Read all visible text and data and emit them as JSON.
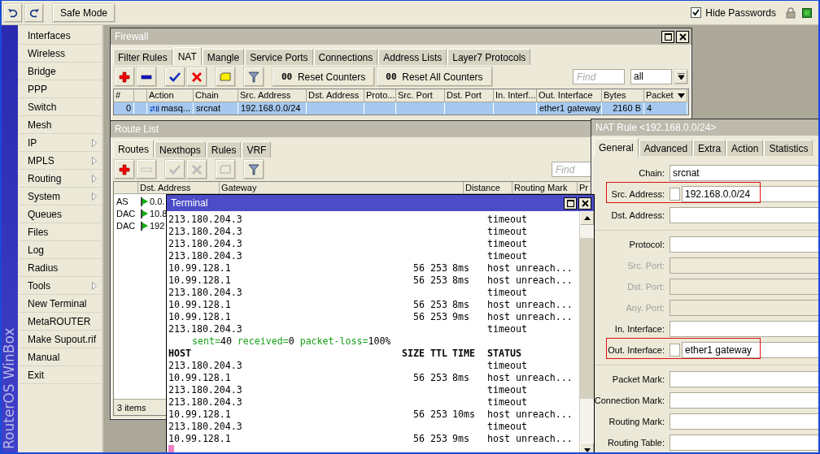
{
  "top_bar": {
    "safe_mode": "Safe Mode",
    "hide_passwords": {
      "label": "Hide Passwords",
      "checked": true
    }
  },
  "sidebar": {
    "brand": "RouterOS WinBox",
    "items": [
      {
        "label": "Interfaces",
        "submenu": false
      },
      {
        "label": "Wireless",
        "submenu": false
      },
      {
        "label": "Bridge",
        "submenu": false
      },
      {
        "label": "PPP",
        "submenu": false
      },
      {
        "label": "Switch",
        "submenu": false
      },
      {
        "label": "Mesh",
        "submenu": false
      },
      {
        "label": "IP",
        "submenu": true
      },
      {
        "label": "MPLS",
        "submenu": true
      },
      {
        "label": "Routing",
        "submenu": true
      },
      {
        "label": "System",
        "submenu": true
      },
      {
        "label": "Queues",
        "submenu": false
      },
      {
        "label": "Files",
        "submenu": false
      },
      {
        "label": "Log",
        "submenu": false
      },
      {
        "label": "Radius",
        "submenu": false
      },
      {
        "label": "Tools",
        "submenu": true
      },
      {
        "label": "New Terminal",
        "submenu": false
      },
      {
        "label": "MetaROUTER",
        "submenu": false
      },
      {
        "label": "Make Supout.rif",
        "submenu": false
      },
      {
        "label": "Manual",
        "submenu": false
      },
      {
        "label": "Exit",
        "submenu": false
      }
    ]
  },
  "firewall": {
    "title": "Firewall",
    "active": false,
    "tabs": [
      {
        "label": "Filter Rules",
        "selected": false
      },
      {
        "label": "NAT",
        "selected": true
      },
      {
        "label": "Mangle",
        "selected": false
      },
      {
        "label": "Service Ports",
        "selected": false
      },
      {
        "label": "Connections",
        "selected": false
      },
      {
        "label": "Address Lists",
        "selected": false
      },
      {
        "label": "Layer7 Protocols",
        "selected": false
      }
    ],
    "actions": [
      {
        "kind": "add",
        "disabled": false
      },
      {
        "kind": "remove",
        "disabled": false
      },
      {
        "kind": "enable",
        "disabled": false
      },
      {
        "kind": "disable",
        "disabled": false
      },
      {
        "kind": "comment",
        "disabled": false
      },
      {
        "kind": "filter",
        "disabled": false
      }
    ],
    "counter_buttons": [
      {
        "icon_text": "00",
        "label": "Reset Counters"
      },
      {
        "icon_text": "00",
        "label": "Reset All Counters"
      }
    ],
    "find": {
      "placeholder": "Find"
    },
    "filter_select": {
      "value": "all"
    },
    "columns": [
      "#",
      "",
      "Action",
      "Chain",
      "Src. Address",
      "Dst. Address",
      "Proto...",
      "Src. Port",
      "Dst. Port",
      "In. Interf...",
      "Out. Interface",
      "Bytes",
      "Packet"
    ],
    "rows": [
      {
        "selected": true,
        "cells": [
          "0",
          "",
          "masq...",
          "srcnat",
          "192.168.0.0/24",
          "",
          "",
          "",
          "",
          "",
          "ether1 gateway",
          "2160 B",
          "4"
        ]
      }
    ]
  },
  "route_list": {
    "title": "Route List",
    "active": false,
    "tabs": [
      {
        "label": "Routes",
        "selected": true
      },
      {
        "label": "Nexthops",
        "selected": false
      },
      {
        "label": "Rules",
        "selected": false
      },
      {
        "label": "VRF",
        "selected": false
      }
    ],
    "actions": [
      {
        "kind": "add",
        "disabled": false
      },
      {
        "kind": "remove",
        "disabled": true
      },
      {
        "kind": "enable",
        "disabled": true
      },
      {
        "kind": "disable",
        "disabled": true
      },
      {
        "kind": "comment",
        "disabled": true
      },
      {
        "kind": "filter",
        "disabled": false
      }
    ],
    "find": {
      "placeholder": "Find"
    },
    "columns": [
      "",
      "Dst. Address",
      "Gateway",
      "Distance",
      "Routing Mark",
      "Pr"
    ],
    "rows": [
      {
        "flags": "AS",
        "dst": "0.0."
      },
      {
        "flags": "DAC",
        "dst": "10.8"
      },
      {
        "flags": "DAC",
        "dst": "192"
      }
    ],
    "status": "3 items"
  },
  "terminal": {
    "title": "Terminal",
    "active": true,
    "cursor": true,
    "lines": [
      {
        "kind": "row",
        "host": "213.180.204.3",
        "status": "timeout"
      },
      {
        "kind": "row",
        "host": "213.180.204.3",
        "status": "timeout"
      },
      {
        "kind": "row",
        "host": "213.180.204.3",
        "status": "timeout"
      },
      {
        "kind": "row",
        "host": "213.180.204.3",
        "status": "timeout"
      },
      {
        "kind": "row",
        "host": "10.99.128.1",
        "size": "56",
        "ttl": "253",
        "time": "8ms",
        "status": "host unreach..."
      },
      {
        "kind": "row",
        "host": "10.99.128.1",
        "size": "56",
        "ttl": "253",
        "time": "8ms",
        "status": "host unreach..."
      },
      {
        "kind": "row",
        "host": "213.180.204.3",
        "status": "timeout"
      },
      {
        "kind": "row",
        "host": "10.99.128.1",
        "size": "56",
        "ttl": "253",
        "time": "8ms",
        "status": "host unreach..."
      },
      {
        "kind": "row",
        "host": "10.99.128.1",
        "size": "56",
        "ttl": "253",
        "time": "9ms",
        "status": "host unreach..."
      },
      {
        "kind": "row",
        "host": "213.180.204.3",
        "status": "timeout"
      },
      {
        "kind": "summary",
        "parts": [
          {
            "key": "sent=",
            "value": "40"
          },
          {
            "key": "received=",
            "value": "0"
          },
          {
            "key": "packet-loss=",
            "value": "100%"
          }
        ]
      },
      {
        "kind": "header",
        "host": "HOST",
        "size": "SIZE",
        "ttl": "TTL",
        "time": "TIME",
        "status": "STATUS"
      },
      {
        "kind": "row",
        "host": "213.180.204.3",
        "status": "timeout"
      },
      {
        "kind": "row",
        "host": "10.99.128.1",
        "size": "56",
        "ttl": "253",
        "time": "8ms",
        "status": "host unreach..."
      },
      {
        "kind": "row",
        "host": "213.180.204.3",
        "status": "timeout"
      },
      {
        "kind": "row",
        "host": "213.180.204.3",
        "status": "timeout"
      },
      {
        "kind": "row",
        "host": "10.99.128.1",
        "size": "56",
        "ttl": "253",
        "time": "10ms",
        "status": "host unreach..."
      },
      {
        "kind": "row",
        "host": "213.180.204.3",
        "status": "timeout"
      },
      {
        "kind": "row",
        "host": "10.99.128.1",
        "size": "56",
        "ttl": "253",
        "time": "9ms",
        "status": "host unreach..."
      }
    ]
  },
  "nat_rule": {
    "title": "NAT Rule <192.168.0.0/24>",
    "active": false,
    "tabs": [
      {
        "label": "General",
        "selected": true
      },
      {
        "label": "Advanced",
        "selected": false
      },
      {
        "label": "Extra",
        "selected": false
      },
      {
        "label": "Action",
        "selected": false
      },
      {
        "label": "Statistics",
        "selected": false
      }
    ],
    "fields": [
      {
        "kind": "text",
        "label": "Chain:",
        "value": "srcnat",
        "disabled": false
      },
      {
        "kind": "negatable",
        "label": "Src. Address:",
        "value": "192.168.0.0/24",
        "checked": false,
        "disabled": false,
        "highlighted": true
      },
      {
        "kind": "text",
        "label": "Dst. Address:",
        "disabled": false
      },
      {
        "kind": "separator"
      },
      {
        "kind": "text",
        "label": "Protocol:",
        "disabled": false
      },
      {
        "kind": "text",
        "label": "Src. Port:",
        "disabled": true
      },
      {
        "kind": "text",
        "label": "Dst. Port:",
        "disabled": true
      },
      {
        "kind": "text",
        "label": "Any. Port:",
        "disabled": true
      },
      {
        "kind": "text",
        "label": "In. Interface:",
        "disabled": false
      },
      {
        "kind": "negatable",
        "label": "Out. Interface:",
        "value": "ether1 gateway",
        "checked": false,
        "disabled": false,
        "highlighted": true
      },
      {
        "kind": "separator"
      },
      {
        "kind": "text",
        "label": "Packet Mark:",
        "disabled": false
      },
      {
        "kind": "text",
        "label": "Connection Mark:",
        "disabled": false
      },
      {
        "kind": "text",
        "label": "Routing Mark:",
        "disabled": false
      },
      {
        "kind": "text",
        "label": "Routing Table:",
        "disabled": false
      }
    ]
  }
}
